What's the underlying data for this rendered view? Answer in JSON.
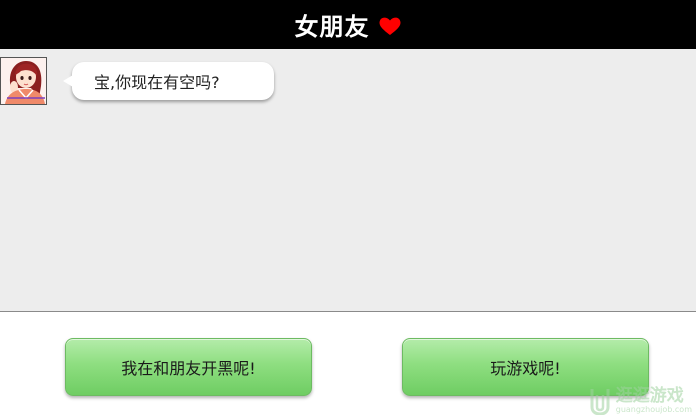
{
  "header": {
    "title": "女朋友",
    "heart_icon": "heart-icon",
    "heart_color": "#ff0000",
    "background": "#000000"
  },
  "chat": {
    "background": "#ededed",
    "messages": [
      {
        "sender": "girlfriend",
        "avatar_icon": "girl-avatar",
        "text": "宝,你现在有空吗?"
      }
    ]
  },
  "choices": {
    "button_color": "#8ede80",
    "options": [
      {
        "label": "我在和朋友开黑呢!"
      },
      {
        "label": "玩游戏呢!"
      }
    ]
  },
  "watermark": {
    "text": "逛逛游戏",
    "url": "guangzhoujob.com"
  }
}
